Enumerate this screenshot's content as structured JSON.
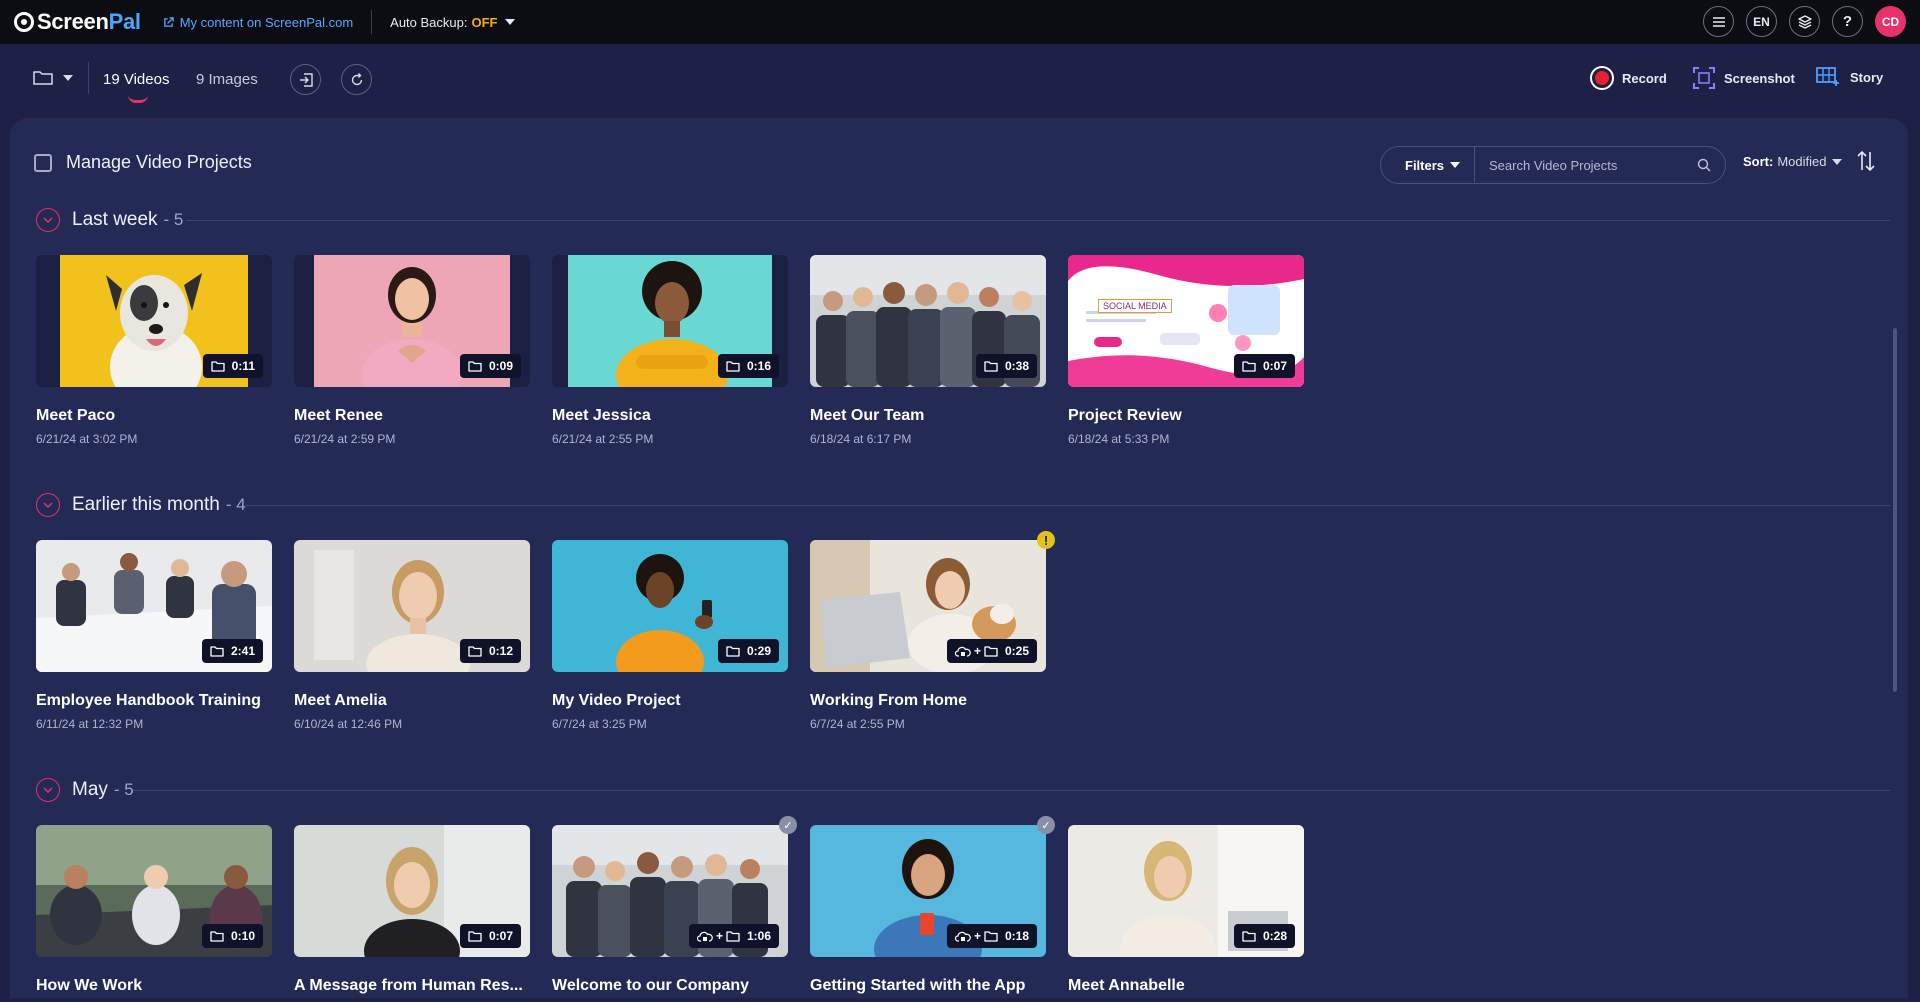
{
  "topbar": {
    "logo_screen": "Screen",
    "logo_pal": "Pal",
    "my_content_prefix": "My content on ",
    "my_content_site": "ScreenPal.com",
    "auto_backup_label": "Auto Backup:",
    "auto_backup_value": "OFF",
    "language": "EN",
    "avatar_initials": "CD"
  },
  "toolbar": {
    "videos_tab": "19 Videos",
    "images_tab": "9 Images",
    "record_label": "Record",
    "screenshot_label": "Screenshot",
    "story_label": "Story"
  },
  "panel": {
    "manage_label": "Manage Video Projects",
    "filters_label": "Filters",
    "search_placeholder": "Search Video Projects",
    "sort_label": "Sort:",
    "sort_value": "Modified"
  },
  "sections": [
    {
      "label": "Last week",
      "count": "- 5",
      "items": [
        {
          "title": "Meet Paco",
          "date": "6/21/24 at 3:02 PM",
          "duration": "0:11"
        },
        {
          "title": "Meet Renee",
          "date": "6/21/24 at 2:59 PM",
          "duration": "0:09"
        },
        {
          "title": "Meet Jessica",
          "date": "6/21/24 at 2:55 PM",
          "duration": "0:16"
        },
        {
          "title": "Meet Our Team",
          "date": "6/18/24 at 6:17 PM",
          "duration": "0:38"
        },
        {
          "title": "Project Review",
          "date": "6/18/24 at 5:33 PM",
          "duration": "0:07",
          "thumb_text": "SOCIAL MEDIA"
        }
      ]
    },
    {
      "label": "Earlier this month",
      "count": "- 4",
      "items": [
        {
          "title": "Employee Handbook Training",
          "date": "6/11/24 at 12:32 PM",
          "duration": "2:41"
        },
        {
          "title": "Meet Amelia",
          "date": "6/10/24 at 12:46 PM",
          "duration": "0:12"
        },
        {
          "title": "My Video Project",
          "date": "6/7/24 at 3:25 PM",
          "duration": "0:29"
        },
        {
          "title": "Working From Home",
          "date": "6/7/24 at 2:55 PM",
          "duration": "0:25"
        }
      ]
    },
    {
      "label": "May",
      "count": "- 5",
      "items": [
        {
          "title": "How We Work",
          "duration": "0:10"
        },
        {
          "title": "A Message from Human Res...",
          "duration": "0:07"
        },
        {
          "title": "Welcome to our Company",
          "duration": "1:06"
        },
        {
          "title": "Getting Started with the App",
          "duration": "0:18"
        },
        {
          "title": "Meet Annabelle",
          "duration": "0:28"
        }
      ]
    }
  ],
  "colors": {
    "accent": "#e8306b",
    "background": "#1c2145",
    "panel": "#222a55",
    "topbar": "#0c0d12",
    "link": "#5aa8ff",
    "backup_off": "#f5a623"
  }
}
